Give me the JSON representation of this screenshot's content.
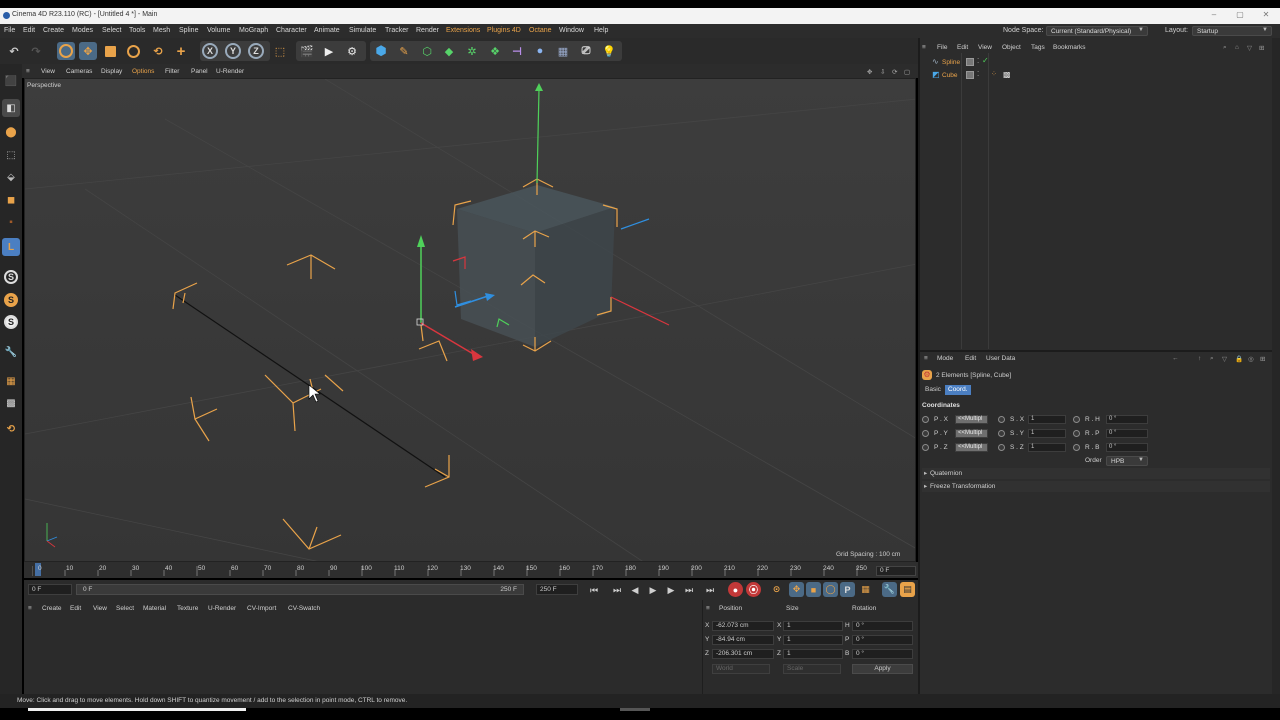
{
  "window": {
    "title": "Cinema 4D R23.110 (RC) - [Untitled 4 *] - Main"
  },
  "menubar": {
    "items": [
      "File",
      "Edit",
      "Create",
      "Modes",
      "Select",
      "Tools",
      "Mesh",
      "Spline",
      "Volume",
      "MoGraph",
      "Character",
      "Animate",
      "Simulate",
      "Tracker",
      "Render",
      "Extensions",
      "Plugins 4D",
      "Octane",
      "Window",
      "Help"
    ],
    "node_space_label": "Node Space:",
    "node_space_value": "Current (Standard/Physical)",
    "layout_label": "Layout:",
    "layout_value": "Startup"
  },
  "toolbar": {
    "axis_x": "X",
    "axis_y": "Y",
    "axis_z": "Z"
  },
  "left_tools": {
    "s1": "S",
    "s2": "S",
    "s3": "S"
  },
  "viewport": {
    "menu": [
      "View",
      "Cameras",
      "Display",
      "Options",
      "Filter",
      "Panel",
      "U-Render"
    ],
    "label": "Perspective",
    "grid_spacing": "Grid Spacing : 100 cm"
  },
  "timeline": {
    "ticks": [
      "0",
      "10",
      "20",
      "30",
      "40",
      "50",
      "60",
      "70",
      "80",
      "90",
      "100",
      "110",
      "120",
      "130",
      "140",
      "150",
      "160",
      "170",
      "180",
      "190",
      "200",
      "210",
      "220",
      "230",
      "240",
      "250"
    ],
    "current_frame": "0 F",
    "start_frame": "0 F",
    "range_start": "0 F",
    "range_end": "250 F",
    "end_frame": "250 F"
  },
  "material_manager": {
    "menu": [
      "Create",
      "Edit",
      "View",
      "Select",
      "Material",
      "Texture",
      "U-Render",
      "CV-Import",
      "CV-Swatch"
    ]
  },
  "coordinate_manager": {
    "headers": [
      "Position",
      "Size",
      "Rotation"
    ],
    "rows": [
      {
        "axis": "X",
        "position": "-62.073 cm",
        "size_axis": "X",
        "size": "1",
        "rot_axis": "H",
        "rotation": "0 °"
      },
      {
        "axis": "Y",
        "position": "-84.94 cm",
        "size_axis": "Y",
        "size": "1",
        "rot_axis": "P",
        "rotation": "0 °"
      },
      {
        "axis": "Z",
        "position": "-206.301 cm",
        "size_axis": "Z",
        "size": "1",
        "rot_axis": "B",
        "rotation": "0 °"
      }
    ],
    "space": "World",
    "scale_mode": "Scale",
    "apply_label": "Apply"
  },
  "status_bar": {
    "text": "Move: Click and drag to move elements. Hold down SHIFT to quantize movement / add to the selection in point mode, CTRL to remove."
  },
  "object_manager": {
    "menu": [
      "File",
      "Edit",
      "View",
      "Object",
      "Tags",
      "Bookmarks"
    ],
    "objects": [
      {
        "name": "Spline"
      },
      {
        "name": "Cube"
      }
    ]
  },
  "attribute_manager": {
    "menu": [
      "Mode",
      "Edit",
      "User Data"
    ],
    "selection_label": "2 Elements [Spline, Cube]",
    "tabs": [
      "Basic",
      "Coord."
    ],
    "active_tab": "Coord.",
    "section_title": "Coordinates",
    "rows": [
      {
        "p_label": "P . X",
        "p_value": "<<Multipl",
        "s_label": "S . X",
        "s_value": "1",
        "r_label": "R . H",
        "r_value": "0 °"
      },
      {
        "p_label": "P . Y",
        "p_value": "<<Multipl",
        "s_label": "S . Y",
        "s_value": "1",
        "r_label": "R . P",
        "r_value": "0 °"
      },
      {
        "p_label": "P . Z",
        "p_value": "<<Multipl",
        "s_label": "S . Z",
        "s_value": "1",
        "r_label": "R . B",
        "r_value": "0 °"
      }
    ],
    "order_label": "Order",
    "order_value": "HPB",
    "collapsed_sections": [
      "Quaternion",
      "Freeze Transformation"
    ]
  },
  "colors": {
    "accent_orange": "#e9a34a",
    "selection_blue": "#4b7fc2",
    "axis_x": "#d9363e",
    "axis_y": "#4fd15a",
    "axis_z": "#2f8fe0"
  }
}
